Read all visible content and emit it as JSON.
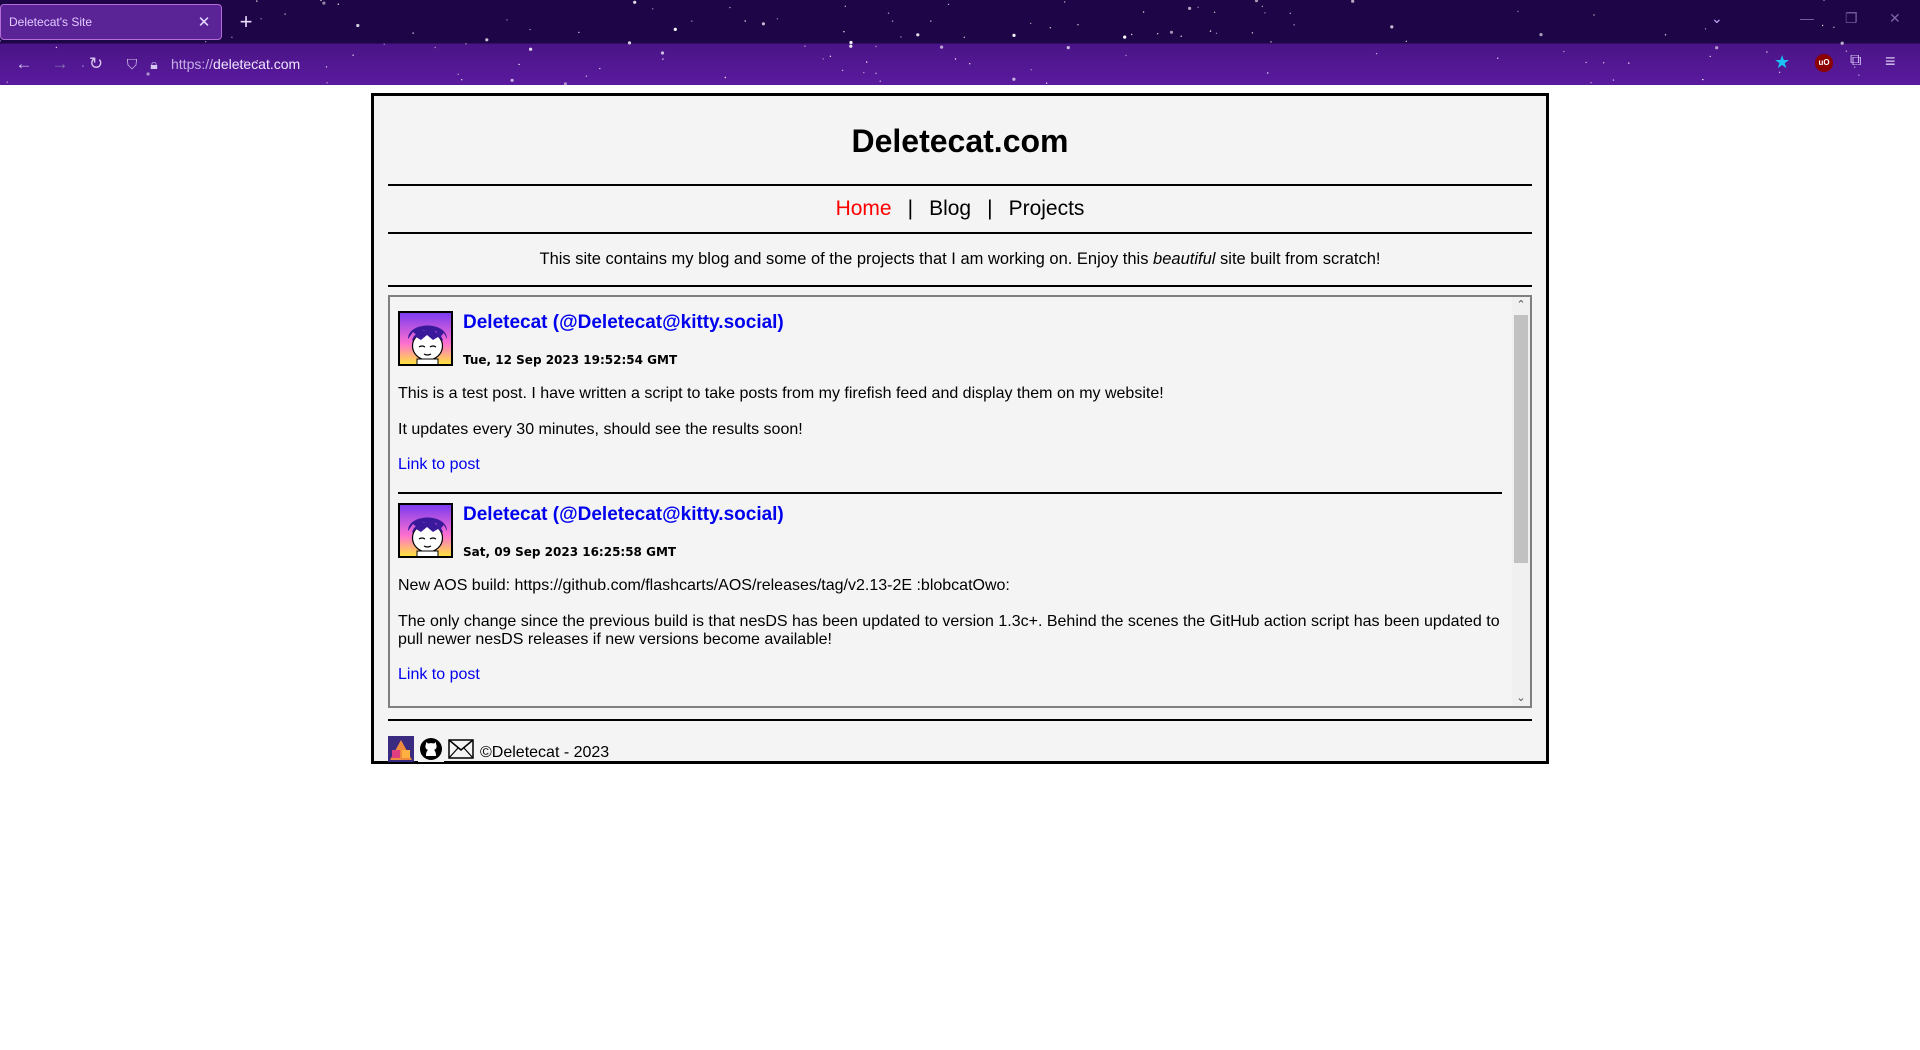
{
  "browser": {
    "tab_title": "Deletecat's Site",
    "tab_close": "✕",
    "new_tab": "+",
    "url_scheme": "https://",
    "url_host": "deletecat.com",
    "ublock_label": "uO"
  },
  "site": {
    "title": "Deletecat.com",
    "nav": {
      "home": "Home",
      "blog": "Blog",
      "projects": "Projects",
      "separator": "|"
    },
    "intro": {
      "before": "This site contains my blog and some of the projects that I am working on. Enjoy this ",
      "emphasis": "beautiful",
      "after": " site built from scratch!"
    },
    "posts": [
      {
        "author": "Deletecat (@Deletecat@kitty.social)",
        "date": "Tue, 12 Sep 2023 19:52:54 GMT",
        "paragraphs": [
          "This is a test post. I have written a script to take posts from my firefish feed and display them on my website!",
          "It updates every 30 minutes, should see the results soon!"
        ],
        "link": "Link to post"
      },
      {
        "author": "Deletecat (@Deletecat@kitty.social)",
        "date": "Sat, 09 Sep 2023 16:25:58 GMT",
        "paragraphs": [
          "New AOS build: https://github.com/flashcarts/AOS/releases/tag/v2.13-2E :blobcatOwo:",
          "The only change since the previous build is that nesDS has been updated to version 1.3c+. Behind the scenes the GitHub action script has been updated to pull newer nesDS releases if new versions become available!"
        ],
        "link": "Link to post"
      }
    ],
    "footer": {
      "copyright": "©Deletecat - 2023"
    }
  }
}
